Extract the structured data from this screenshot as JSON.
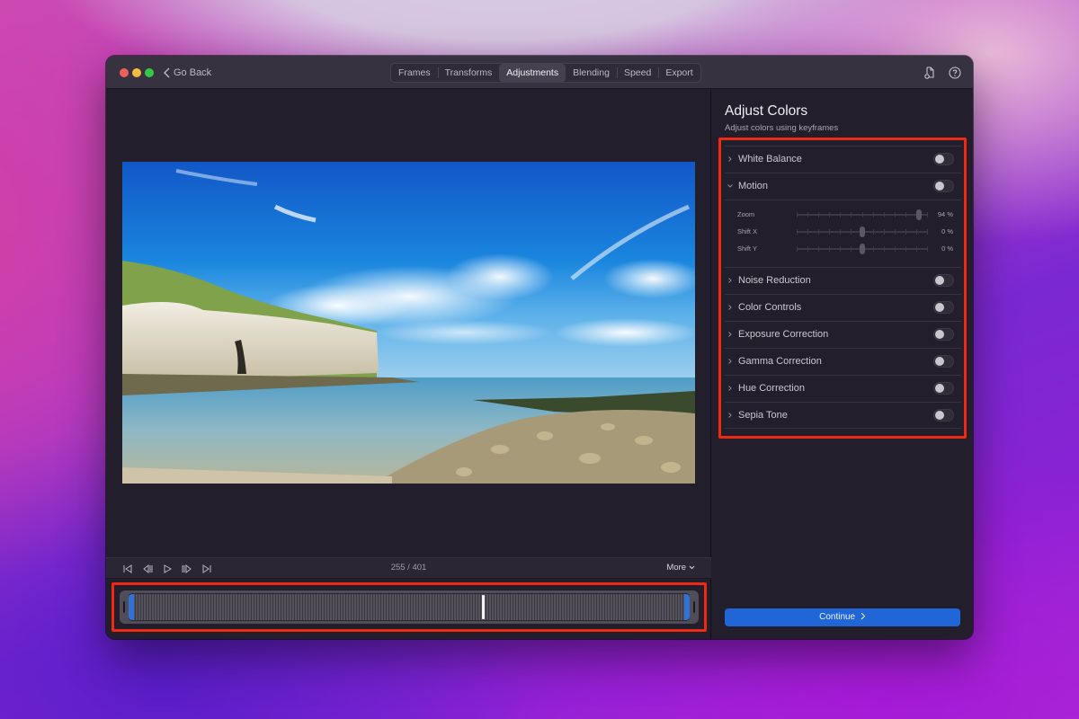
{
  "window": {
    "go_back_label": "Go Back",
    "tabs": [
      {
        "label": "Frames",
        "active": false
      },
      {
        "label": "Transforms",
        "active": false
      },
      {
        "label": "Adjustments",
        "active": true
      },
      {
        "label": "Blending",
        "active": false
      },
      {
        "label": "Speed",
        "active": false
      },
      {
        "label": "Export",
        "active": false
      }
    ],
    "toolbar_icons": [
      "export-document-icon",
      "help-icon"
    ]
  },
  "preview": {
    "image_description": "Coastal landscape: white chalk cliffs with green grass, blue sky with white clouds, calm sea and rocky shore"
  },
  "playback": {
    "controls": [
      "skip-to-start-icon",
      "step-back-icon",
      "play-icon",
      "step-forward-icon",
      "skip-to-end-icon"
    ],
    "frame_counter": "255 / 401",
    "current_frame": 255,
    "total_frames": 401,
    "more_label": "More"
  },
  "timeline": {
    "playhead_fraction": 0.635,
    "trim_start_fraction": 0.0,
    "trim_end_fraction": 1.0
  },
  "panel": {
    "title": "Adjust Colors",
    "subtitle": "Adjust colors using keyframes",
    "adjustments": [
      {
        "label": "White Balance",
        "expanded": false,
        "enabled": false
      },
      {
        "label": "Motion",
        "expanded": true,
        "enabled": false
      },
      {
        "label": "Noise Reduction",
        "expanded": false,
        "enabled": false
      },
      {
        "label": "Color Controls",
        "expanded": false,
        "enabled": false
      },
      {
        "label": "Exposure Correction",
        "expanded": false,
        "enabled": false
      },
      {
        "label": "Gamma Correction",
        "expanded": false,
        "enabled": false
      },
      {
        "label": "Hue Correction",
        "expanded": false,
        "enabled": false
      },
      {
        "label": "Sepia Tone",
        "expanded": false,
        "enabled": false
      }
    ],
    "motion_sliders": [
      {
        "label": "Zoom",
        "value_text": "94 %",
        "position_fraction": 0.94
      },
      {
        "label": "Shift X",
        "value_text": "0 %",
        "position_fraction": 0.5
      },
      {
        "label": "Shift Y",
        "value_text": "0 %",
        "position_fraction": 0.5
      }
    ],
    "continue_label": "Continue"
  },
  "colors": {
    "accent_blue": "#2066d6",
    "highlight_red": "#f02a12",
    "window_bg": "#221e2b"
  }
}
